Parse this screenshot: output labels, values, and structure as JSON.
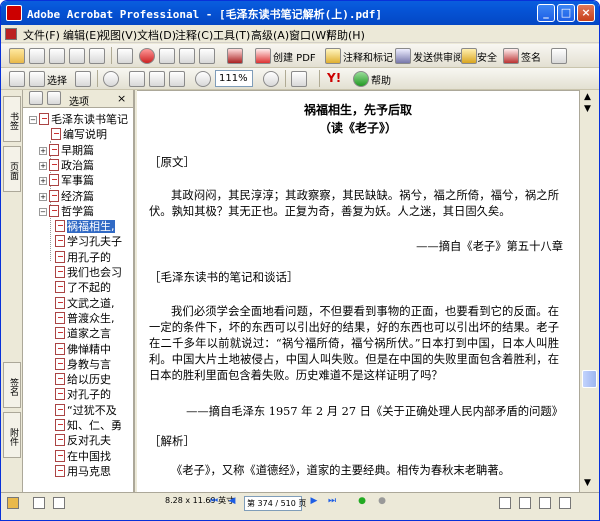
{
  "window": {
    "title": "Adobe Acrobat Professional - [毛泽东读书笔记解析(上).pdf]",
    "min_label": "_",
    "max_label": "□",
    "close_label": "×"
  },
  "menu": [
    "文件(F)",
    "编辑(E)",
    "视图(V)",
    "文档(D)",
    "注释(C)",
    "工具(T)",
    "高级(A)",
    "窗口(W)",
    "帮助(H)"
  ],
  "toolbar1": {
    "create_pdf": "创建 PDF",
    "review": "注释和标记",
    "send_review": "发送供审阅",
    "security": "安全",
    "sign": "签名"
  },
  "toolbar2": {
    "select": "选择",
    "zoom": "111%",
    "help": "帮助",
    "yahoo": "Y!"
  },
  "nav_tabs": [
    "书签",
    "页面",
    "签名",
    "附件"
  ],
  "bookmarks": {
    "options": "选项",
    "items": [
      {
        "label": "毛泽东读书笔记",
        "level": 0,
        "pm": "−"
      },
      {
        "label": "编写说明",
        "level": 1,
        "pm": ""
      },
      {
        "label": "早期篇",
        "level": 1,
        "pm": "+"
      },
      {
        "label": "政治篇",
        "level": 1,
        "pm": "+"
      },
      {
        "label": "军事篇",
        "level": 1,
        "pm": "+"
      },
      {
        "label": "经济篇",
        "level": 1,
        "pm": "+"
      },
      {
        "label": "哲学篇",
        "level": 1,
        "pm": "−"
      },
      {
        "label": "祸福相生,",
        "level": 2,
        "pm": "",
        "selected": true
      },
      {
        "label": "学习孔夫子",
        "level": 2,
        "pm": ""
      },
      {
        "label": "用孔子的",
        "level": 2,
        "pm": ""
      },
      {
        "label": "我们也会习",
        "level": 2,
        "pm": ""
      },
      {
        "label": "了不起的",
        "level": 2,
        "pm": ""
      },
      {
        "label": "文武之道,",
        "level": 2,
        "pm": ""
      },
      {
        "label": "普渡众生,",
        "level": 2,
        "pm": ""
      },
      {
        "label": "道家之言",
        "level": 2,
        "pm": ""
      },
      {
        "label": "佛惮精中",
        "level": 2,
        "pm": ""
      },
      {
        "label": "身教与言",
        "level": 2,
        "pm": ""
      },
      {
        "label": "给以历史",
        "level": 2,
        "pm": ""
      },
      {
        "label": "对孔子的",
        "level": 2,
        "pm": ""
      },
      {
        "label": "“过犹不及",
        "level": 2,
        "pm": ""
      },
      {
        "label": "知、仁、勇",
        "level": 2,
        "pm": ""
      },
      {
        "label": "反对孔夫",
        "level": 2,
        "pm": ""
      },
      {
        "label": "在中国找",
        "level": 2,
        "pm": ""
      },
      {
        "label": "用马克思",
        "level": 2,
        "pm": ""
      }
    ]
  },
  "document": {
    "title": "祸福相生，先予后取",
    "subtitle": "（读《老子》）",
    "h1": "［原文］",
    "p1": "其政闷闷，其民淳淳；其政察察，其民缺缺。祸兮，福之所倚，福兮，祸之所伏。孰知其极？其无正也。正复为奇，善复为妖。人之迷，其日固久矣。",
    "cite1": "——摘自《老子》第五十八章",
    "h2": "［毛泽东读书的笔记和谈话］",
    "p2": "我们必须学会全面地看问题，不但要看到事物的正面，也要看到它的反面。在一定的条件下，坏的东西可以引出好的结果，好的东西也可以引出坏的结果。老子在二千多年以前就说过：“祸兮福所倚，福兮祸所伏。”日本打到中国，日本人叫胜利。中国大片土地被侵占，中国人叫失败。但是在中国的失败里面包含着胜利，在日本的胜利里面包含着失败。历史难道不是这样证明了吗？",
    "cite2": "——摘自毛泽东 1957 年 2 月 27 日《关于正确处理人民内部矛盾的问题》",
    "h3": "［解析］",
    "p3": "《老子》，又称《道德经》，道家的主要经典。相传为春秋末老聃著。"
  },
  "status": {
    "page_size": "8.28 x 11.69 英寸",
    "page_indicator": "第 374 / 510 页"
  }
}
